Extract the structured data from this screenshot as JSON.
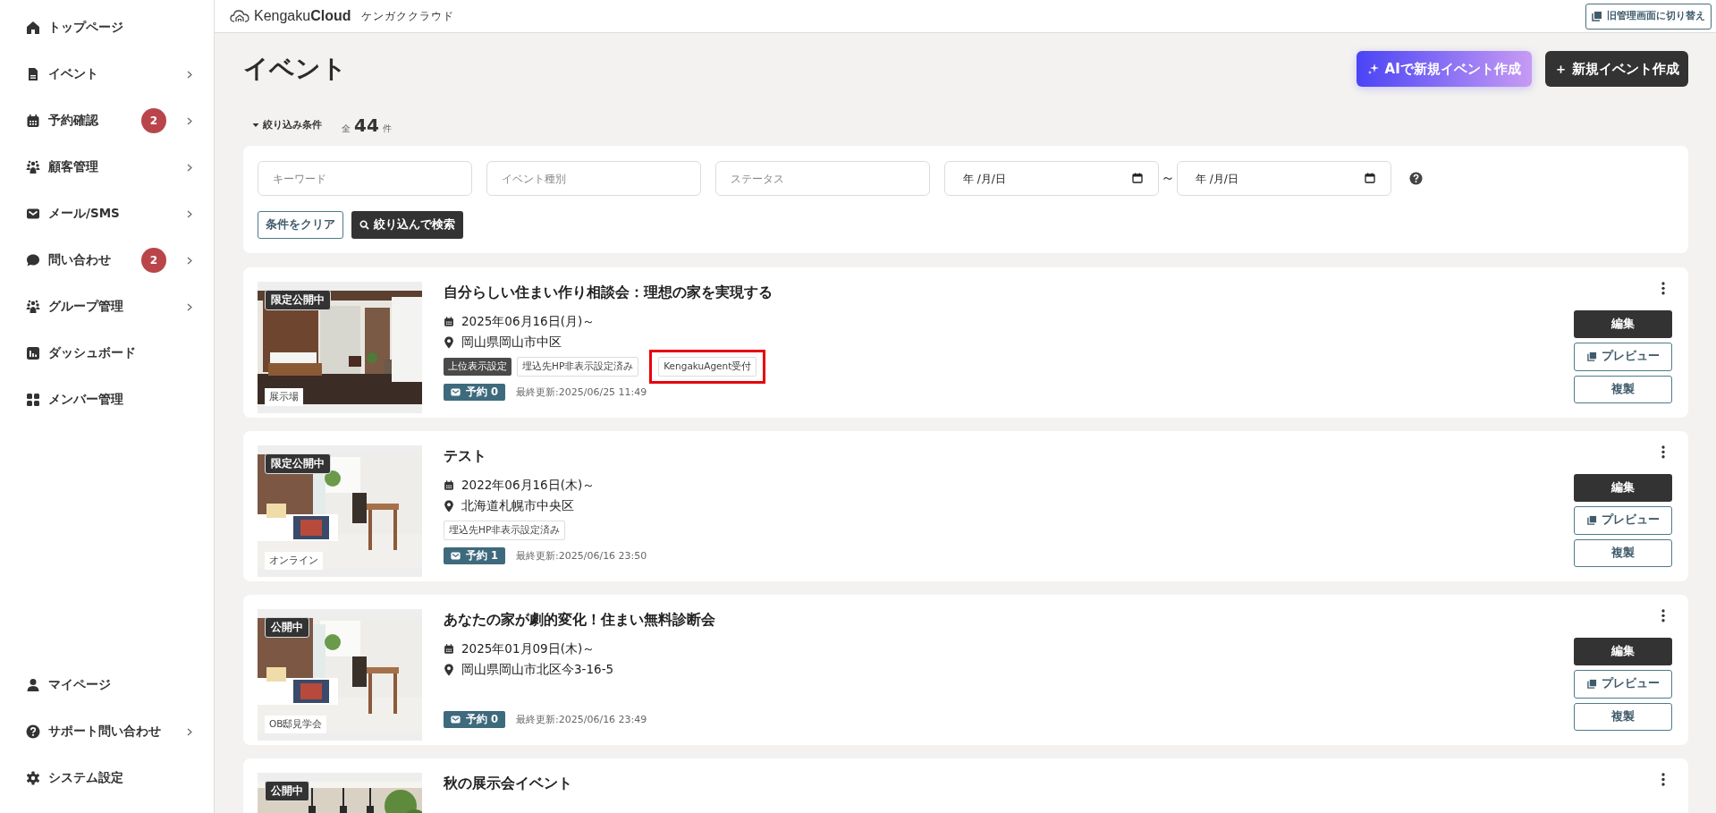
{
  "sidebar": {
    "items": [
      {
        "label": "トップページ",
        "chevron": false
      },
      {
        "label": "イベント",
        "chevron": true
      },
      {
        "label": "予約確認",
        "badge": "2",
        "chevron": true
      },
      {
        "label": "顧客管理",
        "chevron": true
      },
      {
        "label": "メール/SMS",
        "chevron": true
      },
      {
        "label": "問い合わせ",
        "badge": "2",
        "chevron": true
      },
      {
        "label": "グループ管理",
        "chevron": true
      },
      {
        "label": "ダッシュボード",
        "chevron": false
      },
      {
        "label": "メンバー管理",
        "chevron": false
      }
    ],
    "bottom_items": [
      {
        "label": "マイページ",
        "chevron": false
      },
      {
        "label": "サポート問い合わせ",
        "chevron": true
      },
      {
        "label": "システム設定",
        "chevron": false
      }
    ]
  },
  "header": {
    "logo": "Kengaku**Cloud**",
    "logo_kana": "ケンガククラウド",
    "switch_button": "旧管理画面に切り替え"
  },
  "page": {
    "title": "イベント",
    "ai_button": "AIで新規イベント作成",
    "new_button": "＋ 新規イベント作成"
  },
  "filter": {
    "toggle": "絞り込み条件",
    "expanded": true,
    "total_prefix": "全",
    "total": "44",
    "total_suffix": "件",
    "fields": [
      {
        "placeholder": "キーワード"
      },
      {
        "placeholder": "イベント種別"
      },
      {
        "placeholder": "ステータス"
      }
    ],
    "date_from": {
      "placeholder": "年 /月/日"
    },
    "range_sep": "～",
    "date_to": {
      "placeholder": "年 /月/日"
    },
    "clear_button": "条件をクリア",
    "search_button": "絞り込んで検索"
  },
  "events": [
    {
      "status": "限定公開中",
      "category": "展示場",
      "title": "自分らしい住まい作り相談会：理想の家を実現する",
      "date": "2025年06月16日(月)～",
      "location": "岡山県岡山市中区",
      "tags": [
        {
          "kind": "dark",
          "label": "上位表示設定",
          "highlighted": false
        },
        {
          "kind": "outline",
          "label": "埋込先HP非表示設定済み",
          "highlighted": false
        },
        {
          "kind": "outline",
          "label": "KengakuAgent受付",
          "highlighted": true
        }
      ],
      "reservations": "予約 0",
      "updated": "最終更新:2025/06/25 11:49",
      "buttons": [
        {
          "kind": "edit",
          "label": "編集"
        },
        {
          "kind": "preview",
          "label": "プレビュー"
        },
        {
          "kind": "copy",
          "label": "複製"
        }
      ]
    },
    {
      "status": "限定公開中",
      "category": "オンライン",
      "title": "テスト",
      "date": "2022年06月16日(木)～",
      "location": "北海道札幌市中央区",
      "tags": [
        {
          "kind": "outline",
          "label": "埋込先HP非表示設定済み",
          "highlighted": false
        }
      ],
      "reservations": "予約 1",
      "updated": "最終更新:2025/06/16 23:50",
      "buttons": [
        {
          "kind": "edit",
          "label": "編集"
        },
        {
          "kind": "preview",
          "label": "プレビュー"
        },
        {
          "kind": "copy",
          "label": "複製"
        }
      ]
    },
    {
      "status": "公開中",
      "category": "OB邸見学会",
      "title": "あなたの家が劇的変化！住まい無料診断会",
      "date": "2025年01月09日(木)～",
      "location": "岡山県岡山市北区今3-16-5",
      "reservations": "予約 0",
      "updated": "最終更新:2025/06/16 23:49",
      "buttons": [
        {
          "kind": "edit",
          "label": "編集"
        },
        {
          "kind": "preview",
          "label": "プレビュー"
        },
        {
          "kind": "copy",
          "label": "複製"
        }
      ]
    },
    {
      "status": "公開中",
      "title": "秋の展示会イベント"
    }
  ]
}
